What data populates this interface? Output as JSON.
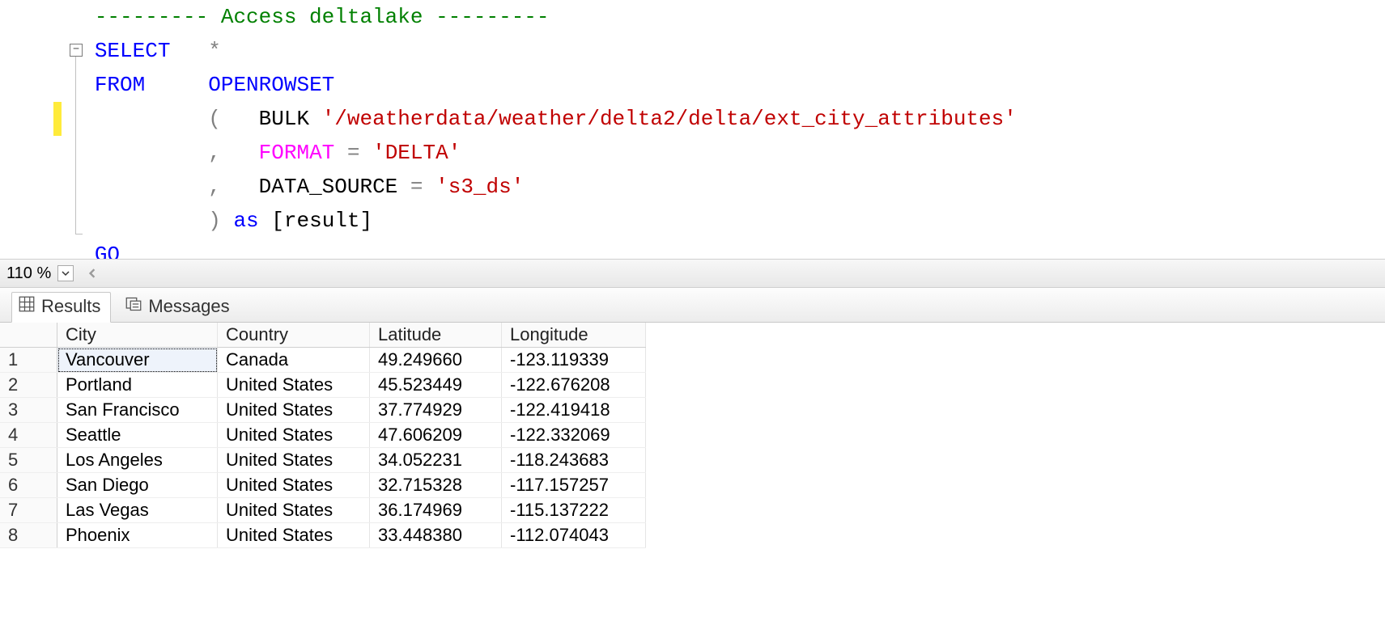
{
  "editor": {
    "comment_line": "--------- Access deltalake ---------",
    "kw_select": "SELECT",
    "star": "*",
    "kw_from": "FROM",
    "fn_openrowset": "OPENROWSET",
    "paren_open": "(",
    "arg_bulk": "BULK",
    "str_bulk": "'/weatherdata/weather/delta2/delta/ext_city_attributes'",
    "comma1": ",",
    "arg_format": "FORMAT",
    "eq1": " = ",
    "str_format": "'DELTA'",
    "comma2": ",",
    "arg_ds": "DATA_SOURCE",
    "eq2": " = ",
    "str_ds": "'s3_ds'",
    "paren_close": ")",
    "kw_as": "as",
    "alias": "[result]",
    "kw_go": "GO",
    "fold_glyph": "−"
  },
  "zoom": {
    "value": "110 %"
  },
  "tabs": {
    "results": "Results",
    "messages": "Messages"
  },
  "grid": {
    "headers": {
      "rownum": "",
      "city": "City",
      "country": "Country",
      "lat": "Latitude",
      "lon": "Longitude"
    },
    "rows": [
      {
        "n": "1",
        "city": "Vancouver",
        "country": "Canada",
        "lat": "49.249660",
        "lon": "-123.119339"
      },
      {
        "n": "2",
        "city": "Portland",
        "country": "United States",
        "lat": "45.523449",
        "lon": "-122.676208"
      },
      {
        "n": "3",
        "city": "San Francisco",
        "country": "United States",
        "lat": "37.774929",
        "lon": "-122.419418"
      },
      {
        "n": "4",
        "city": "Seattle",
        "country": "United States",
        "lat": "47.606209",
        "lon": "-122.332069"
      },
      {
        "n": "5",
        "city": "Los Angeles",
        "country": "United States",
        "lat": "34.052231",
        "lon": "-118.243683"
      },
      {
        "n": "6",
        "city": "San Diego",
        "country": "United States",
        "lat": "32.715328",
        "lon": "-117.157257"
      },
      {
        "n": "7",
        "city": "Las Vegas",
        "country": "United States",
        "lat": "36.174969",
        "lon": "-115.137222"
      },
      {
        "n": "8",
        "city": "Phoenix",
        "country": "United States",
        "lat": "33.448380",
        "lon": "-112.074043"
      }
    ]
  }
}
